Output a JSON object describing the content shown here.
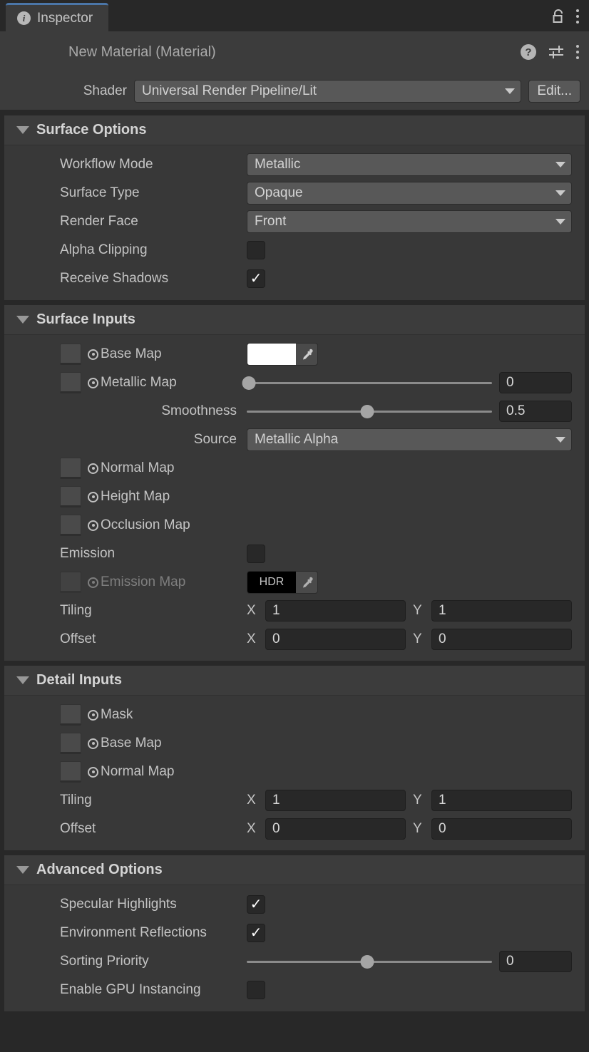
{
  "window": {
    "tab_label": "Inspector",
    "tab_icon": "info-circle-icon",
    "lock_icon": "padlock-unlocked-icon",
    "menu_icon": "kebab-menu-icon"
  },
  "material_header": {
    "title": "New Material (Material)",
    "help_icon": "help-question-icon",
    "preset_icon": "preset-sliders-icon",
    "menu_icon": "kebab-menu-icon"
  },
  "shader_row": {
    "label": "Shader",
    "value": "Universal Render Pipeline/Lit",
    "edit_label": "Edit..."
  },
  "sections": {
    "surface_options": {
      "title": "Surface Options",
      "workflow_mode": {
        "label": "Workflow Mode",
        "value": "Metallic"
      },
      "surface_type": {
        "label": "Surface Type",
        "value": "Opaque"
      },
      "render_face": {
        "label": "Render Face",
        "value": "Front"
      },
      "alpha_clipping": {
        "label": "Alpha Clipping",
        "checked": ""
      },
      "receive_shadows": {
        "label": "Receive Shadows",
        "checked": "✓"
      }
    },
    "surface_inputs": {
      "title": "Surface Inputs",
      "base_map": {
        "label": "Base Map",
        "color": "#ffffff"
      },
      "metallic_map": {
        "label": "Metallic Map",
        "value": "0",
        "slider_pct": 1
      },
      "smoothness": {
        "label": "Smoothness",
        "value": "0.5",
        "slider_pct": 49
      },
      "source": {
        "label": "Source",
        "value": "Metallic Alpha"
      },
      "normal_map": {
        "label": "Normal Map"
      },
      "height_map": {
        "label": "Height Map"
      },
      "occlusion_map": {
        "label": "Occlusion Map"
      },
      "emission": {
        "label": "Emission",
        "checked": ""
      },
      "emission_map": {
        "label": "Emission Map",
        "swatch_label": "HDR",
        "color": "#000000"
      },
      "tiling": {
        "label": "Tiling",
        "x_axis": "X",
        "x": "1",
        "y_axis": "Y",
        "y": "1"
      },
      "offset": {
        "label": "Offset",
        "x_axis": "X",
        "x": "0",
        "y_axis": "Y",
        "y": "0"
      }
    },
    "detail_inputs": {
      "title": "Detail Inputs",
      "mask": {
        "label": "Mask"
      },
      "base_map": {
        "label": "Base Map"
      },
      "normal_map": {
        "label": "Normal Map"
      },
      "tiling": {
        "label": "Tiling",
        "x_axis": "X",
        "x": "1",
        "y_axis": "Y",
        "y": "1"
      },
      "offset": {
        "label": "Offset",
        "x_axis": "X",
        "x": "0",
        "y_axis": "Y",
        "y": "0"
      }
    },
    "advanced_options": {
      "title": "Advanced Options",
      "specular_highlights": {
        "label": "Specular Highlights",
        "checked": "✓"
      },
      "environment_reflections": {
        "label": "Environment Reflections",
        "checked": "✓"
      },
      "sorting_priority": {
        "label": "Sorting Priority",
        "value": "0",
        "slider_pct": 49
      },
      "gpu_instancing": {
        "label": "Enable GPU Instancing",
        "checked": ""
      }
    }
  },
  "colors": {
    "accent_tab": "#4b76a8",
    "panel_bg": "#383838",
    "header_bg": "#3c3c3c",
    "window_bg": "#282828",
    "control_bg": "#585858",
    "field_bg": "#282828",
    "text": "#c4c4c4"
  }
}
